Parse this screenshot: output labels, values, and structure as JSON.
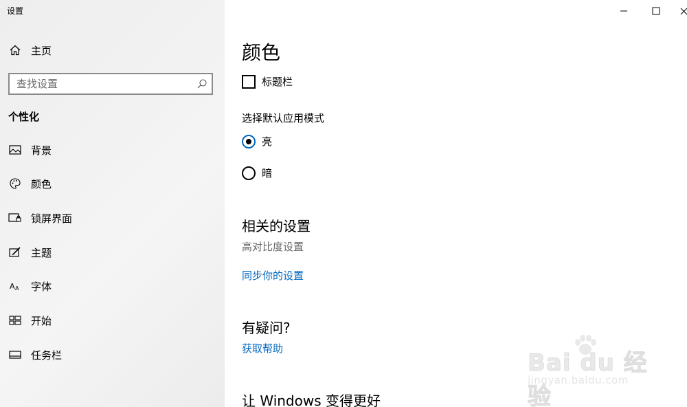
{
  "window": {
    "title": "设置",
    "controls": {
      "minimize": "minimize-icon",
      "maximize": "maximize-icon",
      "close": "close-icon"
    }
  },
  "sidebar": {
    "home_label": "主页",
    "search": {
      "placeholder": "查找设置",
      "value": ""
    },
    "section_title": "个性化",
    "items": [
      {
        "label": "背景",
        "icon": "image-icon"
      },
      {
        "label": "颜色",
        "icon": "palette-icon"
      },
      {
        "label": "锁屏界面",
        "icon": "lock-screen-icon"
      },
      {
        "label": "主题",
        "icon": "theme-icon"
      },
      {
        "label": "字体",
        "icon": "font-icon"
      },
      {
        "label": "开始",
        "icon": "start-icon"
      },
      {
        "label": "任务栏",
        "icon": "taskbar-icon"
      }
    ]
  },
  "main": {
    "title": "颜色",
    "titlebar_checkbox": {
      "label": "标题栏",
      "checked": false
    },
    "app_mode": {
      "label": "选择默认应用模式",
      "options": [
        {
          "label": "亮",
          "selected": true
        },
        {
          "label": "暗",
          "selected": false
        }
      ]
    },
    "related": {
      "heading": "相关的设置",
      "high_contrast": "高对比度设置",
      "sync_link": "同步你的设置"
    },
    "question": {
      "heading": "有疑问?",
      "help_link": "获取帮助"
    },
    "improve_heading": "让 Windows 变得更好"
  },
  "watermark": {
    "main": "Bai du 经验",
    "sub": "jingyan.baidu.com"
  },
  "colors": {
    "accent": "#0067c0",
    "sidebar_bg": "#f0f0f0",
    "muted": "#666666"
  }
}
